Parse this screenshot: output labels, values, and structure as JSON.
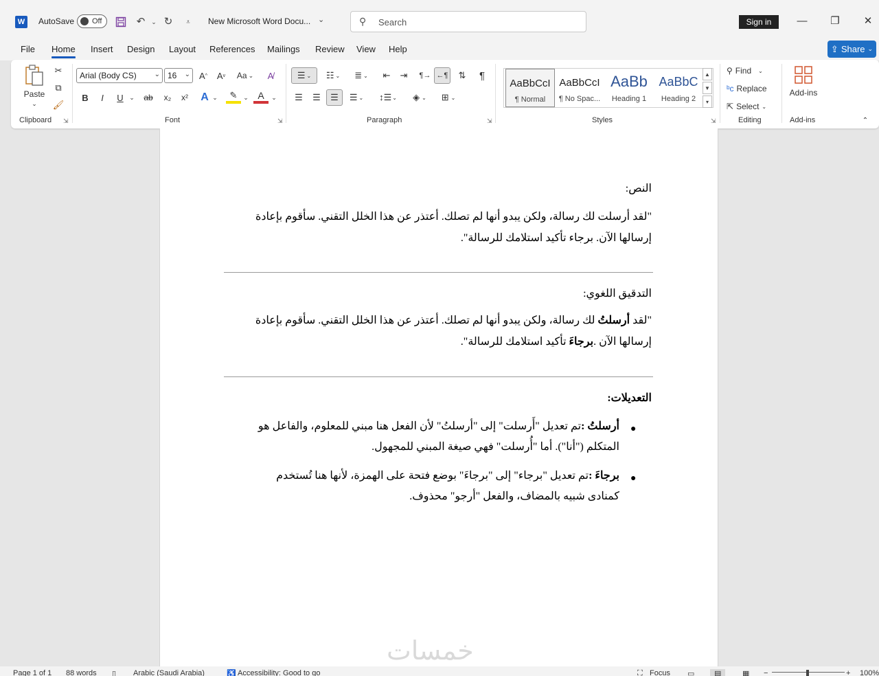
{
  "titlebar": {
    "app_icon": "word-icon",
    "app_letter": "W",
    "autosave_label": "AutoSave",
    "autosave_state": "Off",
    "doc_title": "New Microsoft Word Docu...",
    "search_placeholder": "Search",
    "sign_in": "Sign in"
  },
  "menu": {
    "tabs": [
      "File",
      "Home",
      "Insert",
      "Design",
      "Layout",
      "References",
      "Mailings",
      "Review",
      "View",
      "Help"
    ],
    "active": "Home",
    "share": "Share"
  },
  "ribbon": {
    "clipboard": {
      "label": "Clipboard",
      "paste": "Paste"
    },
    "font": {
      "label": "Font",
      "font_name": "Arial (Body CS)",
      "font_size": "16",
      "bold": "B",
      "italic": "I",
      "underline": "U",
      "change_case": "Aa"
    },
    "paragraph": {
      "label": "Paragraph"
    },
    "styles": {
      "label": "Styles",
      "items": [
        {
          "sample": "AaBbCcI",
          "name": "¶ Normal"
        },
        {
          "sample": "AaBbCcI",
          "name": "¶ No Spac..."
        },
        {
          "sample": "AaBb",
          "name": "Heading 1"
        },
        {
          "sample": "AaBbC",
          "name": "Heading 2"
        }
      ]
    },
    "editing": {
      "label": "Editing",
      "find": "Find",
      "replace": "Replace",
      "select": "Select"
    },
    "addins": {
      "label": "Add-ins",
      "button": "Add-ins"
    }
  },
  "document": {
    "text_heading": "النص:",
    "text_body_line1": "\"لقد أرسلت لك رسالة، ولكن يبدو أنها لم تصلك. أعتذر عن هذا الخلل التقني. سأقوم بإعادة",
    "text_body_line2": "إرسالها الآن. برجاء تأكيد استلامك للرسالة\".",
    "proof_heading": "التدقيق اللغوي:",
    "proof_line1_a": "\"لقد ",
    "proof_line1_bold": "أرسلتُ",
    "proof_line1_b": " لك رسالة، ولكن يبدو أنها لم تصلك. أعتذر عن هذا الخلل التقني. سأقوم بإعادة",
    "proof_line2_a": "إرسالها الآن .",
    "proof_line2_bold": "برجاءَ",
    "proof_line2_b": " تأكيد استلامك للرسالة\".",
    "edits_heading": "التعديلات:",
    "edit1_bold": "أرسلتُ :",
    "edit1_line1": "تم تعديل \"أَرسلت\" إلى \"أرسلتُ\" لأن الفعل هنا مبني للمعلوم، والفاعل هو",
    "edit1_line2": "المتكلم (\"أنا\"). أما \"أُرسلت\" فهي صيغة المبني للمجهول.",
    "edit2_bold": "برجاءَ :",
    "edit2_line1": "تم تعديل \"برجاء\" إلى \"برجاءَ\" بوضع فتحة على الهمزة، لأنها هنا تُستخدم",
    "edit2_line2": "كمنادى شبيه بالمضاف، والفعل \"أرجو\" محذوف.",
    "watermark": "خمسات"
  },
  "status": {
    "page": "Page 1 of 1",
    "words": "88 words",
    "language": "Arabic (Saudi Arabia)",
    "accessibility": "Accessibility: Good to go",
    "focus": "Focus",
    "zoom": "100%"
  },
  "colors": {
    "accent": "#185abd",
    "share": "#1f6fc5",
    "heading_style": "#2f5496"
  }
}
